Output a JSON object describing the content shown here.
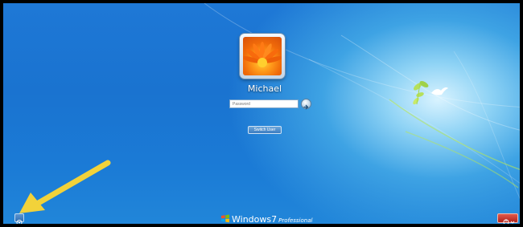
{
  "user": {
    "name": "Michael"
  },
  "password": {
    "placeholder": "Password"
  },
  "switch_user_label": "Switch User",
  "branding": {
    "windows": "Windows",
    "version": "7",
    "edition": "Professional"
  },
  "icons": {
    "submit": "arrow-right-icon",
    "ease_of_access": "ease-of-access-icon",
    "power": "power-icon",
    "annotation": "yellow-arrow-icon"
  },
  "colors": {
    "background": "#1b7bd6",
    "highlight_arrow": "#f2d23a",
    "power_button": "#c2302a"
  }
}
